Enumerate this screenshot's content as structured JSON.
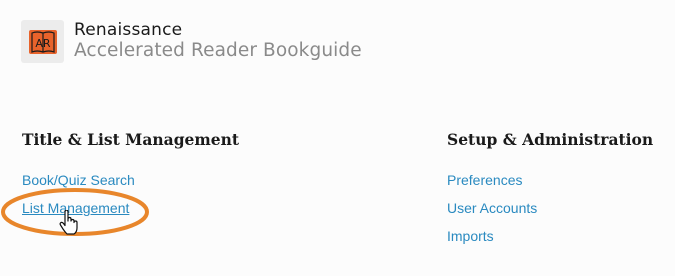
{
  "brand": {
    "name": "Renaissance",
    "product": "Accelerated Reader Bookguide",
    "logo_text": "AR",
    "logo_color": "#e8632b"
  },
  "sections": {
    "left": {
      "title": "Title & List Management",
      "links": [
        "Book/Quiz Search",
        "List Management"
      ]
    },
    "right": {
      "title": "Setup & Administration",
      "links": [
        "Preferences",
        "User Accounts",
        "Imports"
      ]
    }
  },
  "annotation": {
    "highlight_color": "#e8862b",
    "cursor": "hand-pointer-icon"
  },
  "colors": {
    "link": "#2a8ac0",
    "heading": "#1a1a1a",
    "product_text": "#8a8a8a"
  }
}
